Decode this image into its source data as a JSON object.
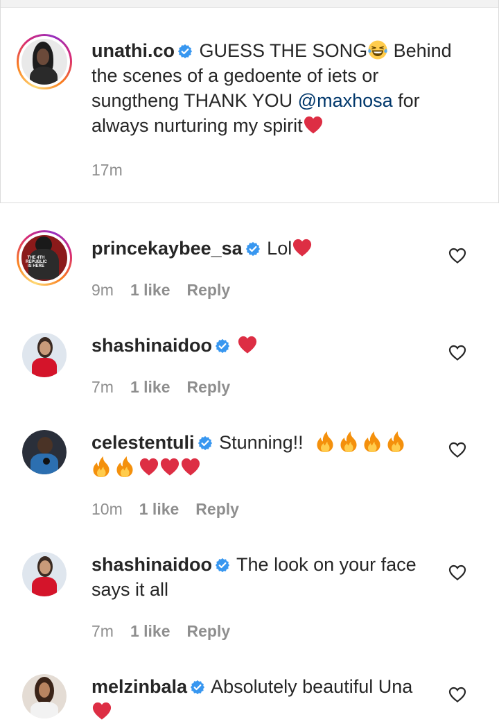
{
  "caption": {
    "username": "unathi.co",
    "text_parts": {
      "p1": "GUESS THE SONG",
      "p2": " Behind",
      "line2": "the scenes of a gedoente of iets or",
      "line3a": "sungtheng THANK YOU ",
      "mention": "@maxhosa",
      "line3b": " for",
      "line4": "always nurturing my spirit"
    },
    "time": "17m"
  },
  "comments": [
    {
      "username": "princekaybee_sa",
      "text": "Lol",
      "time": "9m",
      "likes": "1 like",
      "reply": "Reply",
      "avatar_text": "THE 4TH REPUBLIC IS HERE"
    },
    {
      "username": "shashinaidoo",
      "text": "",
      "time": "7m",
      "likes": "1 like",
      "reply": "Reply"
    },
    {
      "username": "celestentuli",
      "text": "Stunning!!",
      "time": "10m",
      "likes": "1 like",
      "reply": "Reply"
    },
    {
      "username": "shashinaidoo",
      "text_line1": "The look on your face",
      "text_line2": "says it all",
      "time": "7m",
      "likes": "1 like",
      "reply": "Reply"
    },
    {
      "username": "melzinbala",
      "text": "Absolutely beautiful Una"
    }
  ],
  "icons": {
    "verified": "verified-badge-icon",
    "heart_outline": "heart-outline-icon",
    "red_heart": "red-heart-emoji",
    "fire": "fire-emoji",
    "laugh": "tears-of-joy-emoji"
  },
  "colors": {
    "text": "#262626",
    "meta": "#8e8e8e",
    "mention": "#00376b",
    "verified": "#3897f0"
  }
}
